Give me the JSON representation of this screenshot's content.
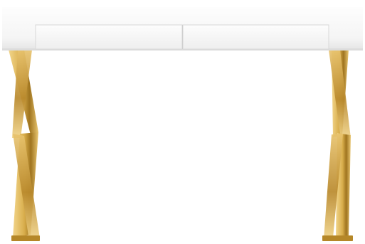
{
  "image": {
    "subject": "",
    "colors": {
      "background": "#ffffff",
      "top": "#f6f6f6",
      "topShadow": "#dcdcdc",
      "drawerFace": "#fbfbfb",
      "drawerEdge": "#d8d8d8",
      "goldLight": "#f2d58a",
      "goldMid": "#c99a35",
      "goldDark": "#8a6118"
    }
  }
}
